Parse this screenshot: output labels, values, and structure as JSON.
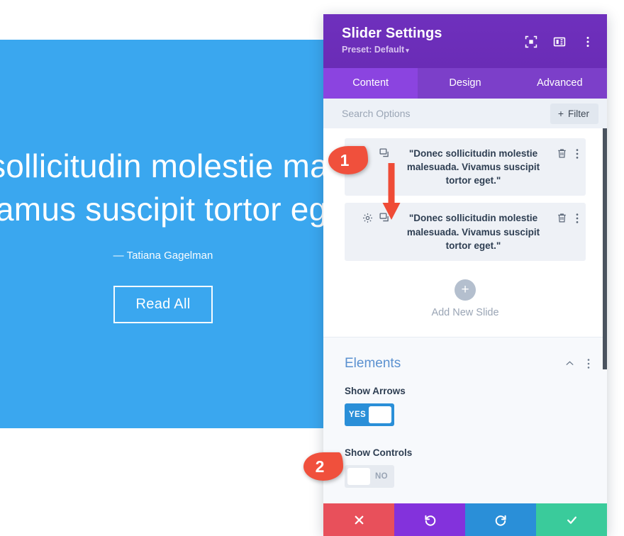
{
  "preview": {
    "quote": "\"Donec sollicitudin molestie malesuada. Vivamus suscipit tortor eget.\"",
    "author": "— Tatiana Gagelman",
    "button_label": "Read All",
    "background_color": "#3aa7ef"
  },
  "panel": {
    "title": "Slider Settings",
    "preset_label": "Preset: Default",
    "preset_caret": "▾",
    "header_icons": [
      "focus-target-icon",
      "layout-columns-icon",
      "kebab-menu-icon"
    ],
    "accent_header_color": "#6c2eb9",
    "tabs": [
      {
        "label": "Content",
        "active": true
      },
      {
        "label": "Design",
        "active": false
      },
      {
        "label": "Advanced",
        "active": false
      }
    ],
    "search": {
      "placeholder": "Search Options",
      "value": "",
      "filter_label": "Filter",
      "filter_plus": "+"
    },
    "slides": [
      {
        "text": "\"Donec sollicitudin molestie malesuada. Vivamus suscipit tortor eget.\"",
        "has_gear": false,
        "left_icons": [
          "duplicate-icon"
        ],
        "right_icons": [
          "trash-icon",
          "kebab-menu-icon"
        ]
      },
      {
        "text": "\"Donec sollicitudin molestie malesuada. Vivamus suscipit tortor eget.\"",
        "has_gear": true,
        "left_icons": [
          "gear-icon",
          "duplicate-icon"
        ],
        "right_icons": [
          "trash-icon",
          "kebab-menu-icon"
        ]
      }
    ],
    "add_slide": {
      "plus": "+",
      "label": "Add New Slide"
    },
    "elements_section": {
      "title": "Elements",
      "collapse_icon": "chevron-up-icon",
      "menu_icon": "kebab-menu-icon",
      "fields": [
        {
          "label": "Show Arrows",
          "state": "on",
          "value_label": "YES"
        },
        {
          "label": "Show Controls",
          "state": "off",
          "value_label": "NO"
        }
      ]
    },
    "footer_buttons": [
      {
        "name": "cancel",
        "icon": "close-icon",
        "color": "#e8505b"
      },
      {
        "name": "undo",
        "icon": "undo-icon",
        "color": "#8332dc"
      },
      {
        "name": "redo",
        "icon": "redo-icon",
        "color": "#2a8fd8"
      },
      {
        "name": "save",
        "icon": "check-icon",
        "color": "#3acb9b"
      }
    ]
  },
  "annotations": {
    "marker_one": "1",
    "marker_two": "2",
    "arrow": "down-arrow",
    "color": "#f0503c"
  }
}
